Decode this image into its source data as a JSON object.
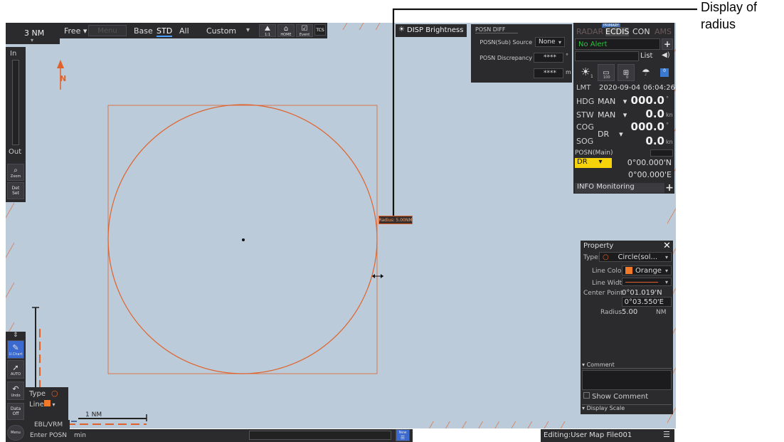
{
  "annotation": {
    "line1": "Display of",
    "line2": "radius"
  },
  "topbar": {
    "range": "3 NM",
    "mode": "Free",
    "disabled_btn": "Menu",
    "base": "Base",
    "std": "STD",
    "all": "All",
    "custom": "Custom",
    "icon_scale": "1:1",
    "icon_home": "HOME",
    "icon_event": "Event",
    "tcs": "TCS",
    "disp_brightness": "DISP Brightness"
  },
  "left_toolbar": {
    "zoom_in": "In",
    "zoom_out": "Out",
    "zoom": "Zoom",
    "det_set_1": "Det",
    "det_set_2": "Set"
  },
  "posn_diff": {
    "title": "POSN DIFF",
    "sub_source_label": "POSN(Sub) Source",
    "sub_source_value": "None",
    "discrepancy_label": "POSN Discrepancy",
    "discrepancy_value": "****",
    "discrepancy_unit": "°",
    "distance_value": "****",
    "distance_unit": "m"
  },
  "mode_tabs": {
    "radar": "RADAR",
    "primary": "PRIMARY",
    "ecdis": "ECDIS",
    "con": "CON",
    "ams": "AMS"
  },
  "alert": {
    "text": "No Alert",
    "list": "List"
  },
  "icons": {
    "brightness_sub": "1",
    "icon2_sub": "100",
    "icon3_sub": "0",
    "icon5_sub": "0"
  },
  "nav": {
    "lmt_label": "LMT",
    "date": "2020-09-04",
    "time": "06:04:26",
    "hdg_label": "HDG",
    "hdg_src": "MAN",
    "hdg_val": "000.0",
    "hdg_unit": "°",
    "stw_label": "STW",
    "stw_src": "MAN",
    "stw_val": "0.0",
    "stw_unit": "kn",
    "cog_label": "COG",
    "cog_val": "000.0",
    "cog_unit": "°",
    "dr_src": "DR",
    "sog_label": "SOG",
    "sog_val": "0.0",
    "sog_unit": "kn",
    "posn_main": "POSN(Main)",
    "posn_src": "DR",
    "lat": "0°00.000'N",
    "lon": "0°00.000'E",
    "info": "INFO Monitoring"
  },
  "chart": {
    "radius_label": "Radius: 5.00NM",
    "north_arrow_label": "N",
    "scale_label": "1 NM",
    "scale_label_v": "1 NM"
  },
  "property": {
    "title": "Property",
    "type_label": "Type:",
    "type_value": "Circle(sol...",
    "line_color_label": "Line Color",
    "line_color_value": "Orange",
    "line_width_label": "Line Width",
    "center_label": "Center Point",
    "center_lat": "0°01.019'N",
    "center_lon": "0°03.550'E",
    "radius_label": "Radius",
    "radius_value": "5.00",
    "radius_unit": "NM",
    "comment": "Comment",
    "show_comment": "Show Comment",
    "display_scale": "Display Scale"
  },
  "bottom_tools": {
    "user_chart": "U.Chart",
    "auto": "AUTO",
    "undo": "Undo",
    "data_off_1": "Data",
    "data_off_2": "Off",
    "menu": "Menu",
    "type_label": "Type",
    "line_label": "Line",
    "ebl_vrm": "EBL/VRM",
    "enter_posn": "Enter POSN",
    "min": "min",
    "new": "New"
  },
  "status": {
    "editing": "Editing:User Map File001"
  },
  "colors": {
    "chart_bg": "#bccbd9",
    "circle": "#e0622a",
    "accent": "#f07a2a",
    "panel": "#2b2b2e"
  }
}
